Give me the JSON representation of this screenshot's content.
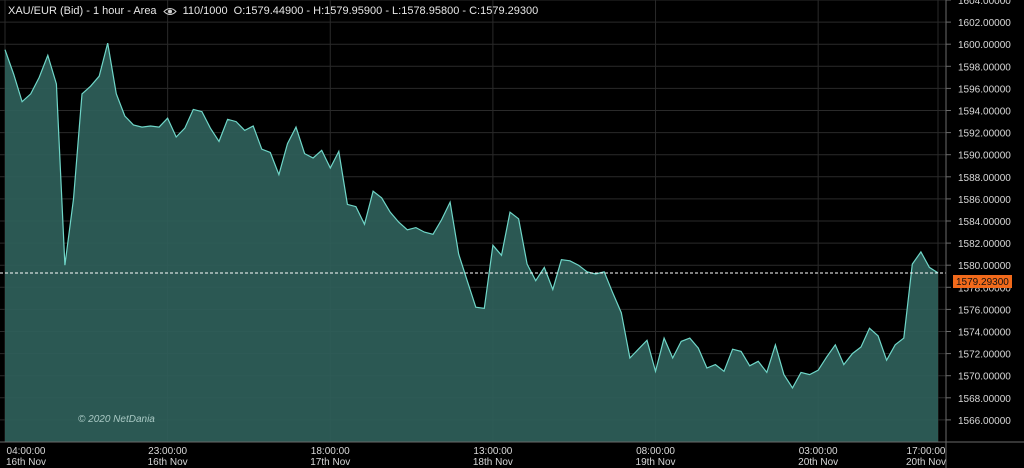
{
  "header": {
    "instrument": "XAU/EUR (Bid) - 1 hour - Area",
    "count": "110/1000",
    "ohlc": "O:1579.44900 - H:1579.95900 - L:1578.95800 - C:1579.29300"
  },
  "watermark": "© 2020 NetDania",
  "last_price_label": "1579.29300",
  "colors": {
    "area_fill": "#2f605a",
    "line": "#6fd6c8",
    "grid": "#2a2a2a",
    "last_tag": "#f26a1b"
  },
  "chart_data": {
    "type": "area",
    "last_price": 1579.293,
    "ylim": [
      1564,
      1604
    ],
    "y_ticks": [
      1566,
      1568,
      1570,
      1572,
      1574,
      1576,
      1578,
      1580,
      1582,
      1584,
      1586,
      1588,
      1590,
      1592,
      1594,
      1596,
      1598,
      1600,
      1602,
      1604
    ],
    "y_tick_labels": [
      "1566.00000",
      "1568.00000",
      "1570.00000",
      "1572.00000",
      "1574.00000",
      "1576.00000",
      "1578.00000",
      "1580.00000",
      "1582.00000",
      "1584.00000",
      "1586.00000",
      "1588.00000",
      "1590.00000",
      "1592.00000",
      "1594.00000",
      "1596.00000",
      "1598.00000",
      "1600.00000",
      "1602.00000",
      "1604.00000"
    ],
    "x_ticks": [
      {
        "index": 0,
        "time": "04:00:00",
        "date": "16th Nov"
      },
      {
        "index": 19,
        "time": "23:00:00",
        "date": "16th Nov"
      },
      {
        "index": 38,
        "time": "18:00:00",
        "date": "17th Nov"
      },
      {
        "index": 57,
        "time": "13:00:00",
        "date": "18th Nov"
      },
      {
        "index": 76,
        "time": "08:00:00",
        "date": "19th Nov"
      },
      {
        "index": 95,
        "time": "03:00:00",
        "date": "20th Nov"
      },
      {
        "index": 109,
        "time": "17:00:00",
        "date": "20th Nov"
      }
    ],
    "values": [
      1599.5,
      1597.3,
      1594.8,
      1595.5,
      1597.0,
      1599.0,
      1596.4,
      1580.0,
      1586.0,
      1595.5,
      1596.2,
      1597.1,
      1600.1,
      1595.5,
      1593.5,
      1592.7,
      1592.5,
      1592.6,
      1592.5,
      1593.3,
      1591.6,
      1592.4,
      1594.1,
      1593.9,
      1592.4,
      1591.2,
      1593.2,
      1593.0,
      1592.2,
      1592.6,
      1590.5,
      1590.2,
      1588.2,
      1591.0,
      1592.5,
      1590.1,
      1589.7,
      1590.4,
      1588.8,
      1590.3,
      1585.5,
      1585.3,
      1583.7,
      1586.7,
      1586.1,
      1584.8,
      1583.9,
      1583.2,
      1583.4,
      1583.0,
      1582.8,
      1584.1,
      1585.7,
      1581.0,
      1578.6,
      1576.2,
      1576.1,
      1581.8,
      1580.9,
      1584.8,
      1584.2,
      1580.1,
      1578.6,
      1579.8,
      1577.8,
      1580.5,
      1580.4,
      1580.0,
      1579.4,
      1579.2,
      1579.4,
      1577.5,
      1575.7,
      1571.6,
      1572.4,
      1573.2,
      1570.4,
      1573.4,
      1571.6,
      1573.1,
      1573.4,
      1572.5,
      1570.7,
      1571.0,
      1570.4,
      1572.4,
      1572.2,
      1570.9,
      1571.3,
      1570.3,
      1572.8,
      1570.1,
      1568.9,
      1570.3,
      1570.1,
      1570.5,
      1571.7,
      1572.8,
      1571.0,
      1572.0,
      1572.6,
      1574.3,
      1573.6,
      1571.4,
      1572.8,
      1573.4,
      1580.1,
      1581.2,
      1579.8,
      1579.3
    ]
  }
}
